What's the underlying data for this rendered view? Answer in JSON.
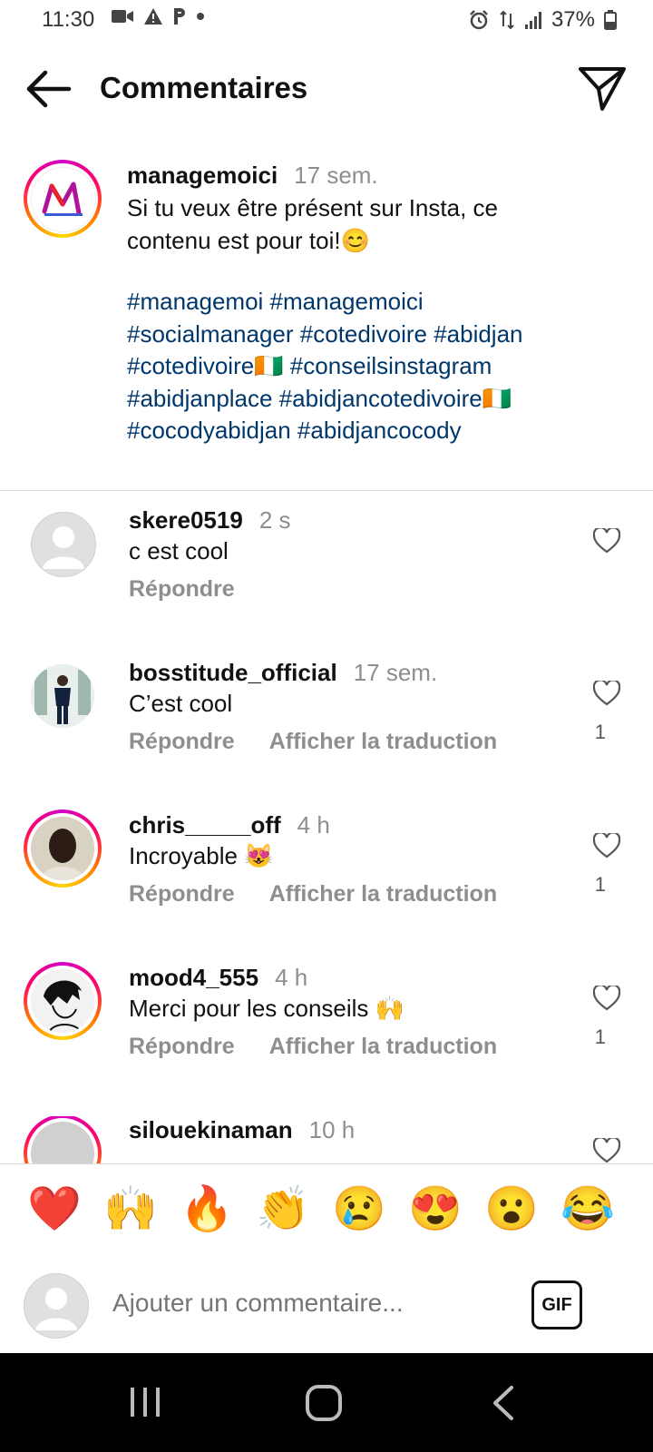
{
  "status_bar": {
    "time": "11:30",
    "battery": "37%"
  },
  "header": {
    "title": "Commentaires"
  },
  "caption": {
    "username": "managemoici",
    "time": "17 sem.",
    "text": "Si tu veux être présent sur Insta, ce contenu est pour toi!😊",
    "hashtag_lines": [
      "#managemoi #managemoici",
      "#socialmanager #cotedivoire #abidjan",
      "#cotedivoire🇨🇮 #conseilsinstagram",
      "#abidjanplace #abidjancotedivoire🇨🇮",
      "#cocodyabidjan #abidjancocody"
    ]
  },
  "comments": [
    {
      "username": "skere0519",
      "time": "2 s",
      "text": "c est cool",
      "reply": "Répondre",
      "translate": "",
      "likes": ""
    },
    {
      "username": "bosstitude_official",
      "time": "17 sem.",
      "text": "C’est cool",
      "reply": "Répondre",
      "translate": "Afficher la traduction",
      "likes": "1"
    },
    {
      "username": "chris_____off",
      "time": "4 h",
      "text": "Incroyable 😻",
      "reply": "Répondre",
      "translate": "Afficher la traduction",
      "likes": "1"
    },
    {
      "username": "mood4_555",
      "time": "4 h",
      "text": "Merci pour les conseils 🙌",
      "reply": "Répondre",
      "translate": "Afficher la traduction",
      "likes": "1"
    },
    {
      "username": "silouekinaman",
      "time": "10 h",
      "text": "",
      "reply": "",
      "translate": "",
      "likes": ""
    }
  ],
  "emoji_bar": [
    "❤️",
    "🙌",
    "🔥",
    "👏",
    "😢",
    "😍",
    "😮",
    "😂"
  ],
  "composer": {
    "placeholder": "Ajouter un commentaire...",
    "gif_label": "GIF"
  },
  "colors": {
    "hashtag": "#00376b",
    "secondary_text": "#8e8e8e",
    "divider": "#dbdbdb"
  }
}
